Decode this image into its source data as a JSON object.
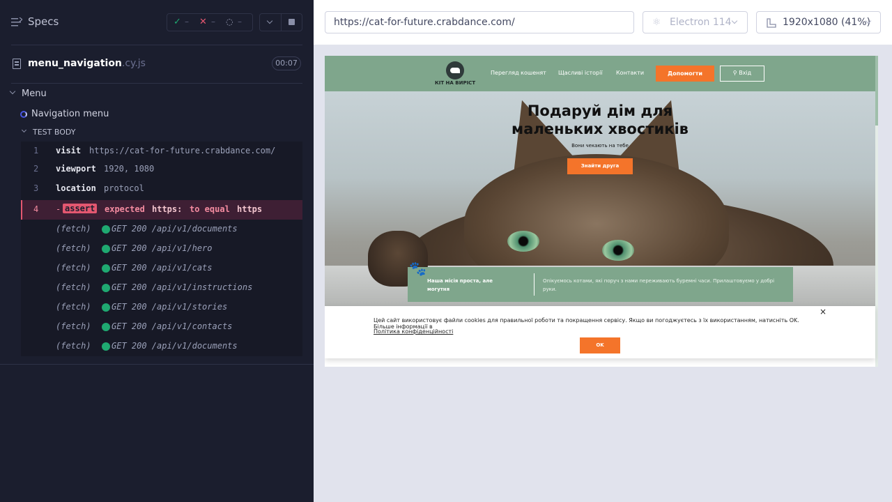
{
  "sidebar": {
    "title": "Specs",
    "stats": {
      "passed": "–",
      "failed": "–",
      "pending": "–"
    },
    "spec": {
      "name": "menu_navigation",
      "ext": ".cy.js",
      "duration": "00:07"
    },
    "suite": "Menu",
    "test": "Navigation menu",
    "section": "TEST BODY",
    "commands": [
      {
        "num": "1",
        "name": "visit",
        "arg": "https://cat-for-future.crabdance.com/"
      },
      {
        "num": "2",
        "name": "viewport",
        "arg": "1920, 1080"
      },
      {
        "num": "3",
        "name": "location",
        "arg": "protocol"
      }
    ],
    "failed_command": {
      "num": "4",
      "prefix": "-",
      "badge": "assert",
      "expected": "expected",
      "actual": "https:",
      "to_equal": "to equal",
      "target": "https"
    },
    "fetches": [
      {
        "label": "(fetch)",
        "detail": "GET 200 /api/v1/documents"
      },
      {
        "label": "(fetch)",
        "detail": "GET 200 /api/v1/hero"
      },
      {
        "label": "(fetch)",
        "detail": "GET 200 /api/v1/cats"
      },
      {
        "label": "(fetch)",
        "detail": "GET 200 /api/v1/instructions"
      },
      {
        "label": "(fetch)",
        "detail": "GET 200 /api/v1/stories"
      },
      {
        "label": "(fetch)",
        "detail": "GET 200 /api/v1/contacts"
      },
      {
        "label": "(fetch)",
        "detail": "GET 200 /api/v1/documents"
      }
    ]
  },
  "toolbar": {
    "url": "https://cat-for-future.crabdance.com/",
    "browser": "Electron 114",
    "viewport": "1920x1080",
    "scale": "(41%)"
  },
  "site": {
    "logo_text": "КІТ НА ВИРІСТ",
    "nav": [
      "Перегляд кошенят",
      "Щасливі історії",
      "Контакти"
    ],
    "help_button": "Допомогти",
    "login_button": "Вхід",
    "hero_title_1": "Подаруй дім для",
    "hero_title_2": "маленьких хвостиків",
    "hero_sub": "Вони чекають на тебе",
    "hero_button": "Знайти друга",
    "mission_title": "Наша місія проста, але могутня",
    "mission_text": "Опікуємось котами, які поруч з нами переживають буремні часи. Прилаштовуємо у добрі руки.",
    "cookie_text": "Цей сайт використовує файли cookies для правильної роботи та покращення сервісу. Якщо ви погоджуєтесь з їх використанням, натисніть OK. Більше інформації в",
    "cookie_link": "Політика конфіденційності",
    "cookie_ok": "OK",
    "cookie_close": "×"
  },
  "colors": {
    "accent_orange": "#f4742a",
    "brand_green": "#7fa68c",
    "fail_red": "#e45770",
    "pass_green": "#1fa971",
    "sidebar_bg": "#1b1e2e"
  }
}
